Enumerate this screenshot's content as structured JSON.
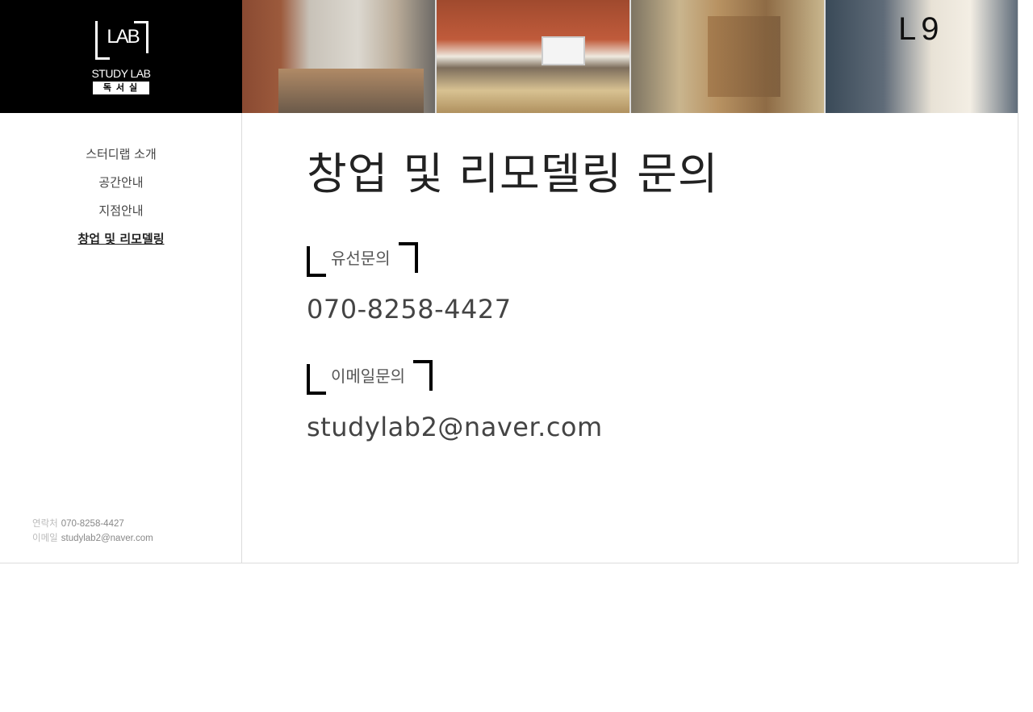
{
  "logo": {
    "mark": "LAB",
    "name": "STUDY LAB",
    "subtitle": "독서실"
  },
  "nav": {
    "items": [
      {
        "label": "스터디랩 소개"
      },
      {
        "label": "공간안내"
      },
      {
        "label": "지점안내"
      },
      {
        "label": "창업 및 리모델링"
      }
    ],
    "active_index": 3
  },
  "sidebar_contact": {
    "phone_label": "연락처",
    "phone": "070-8258-4427",
    "email_label": "이메일",
    "email": "studylab2@naver.com"
  },
  "main": {
    "title": "창업 및 리모델링 문의",
    "phone_section": {
      "heading": "유선문의",
      "value": "070-8258-4427"
    },
    "email_section": {
      "heading": "이메일문의",
      "value": "studylab2@naver.com"
    }
  }
}
